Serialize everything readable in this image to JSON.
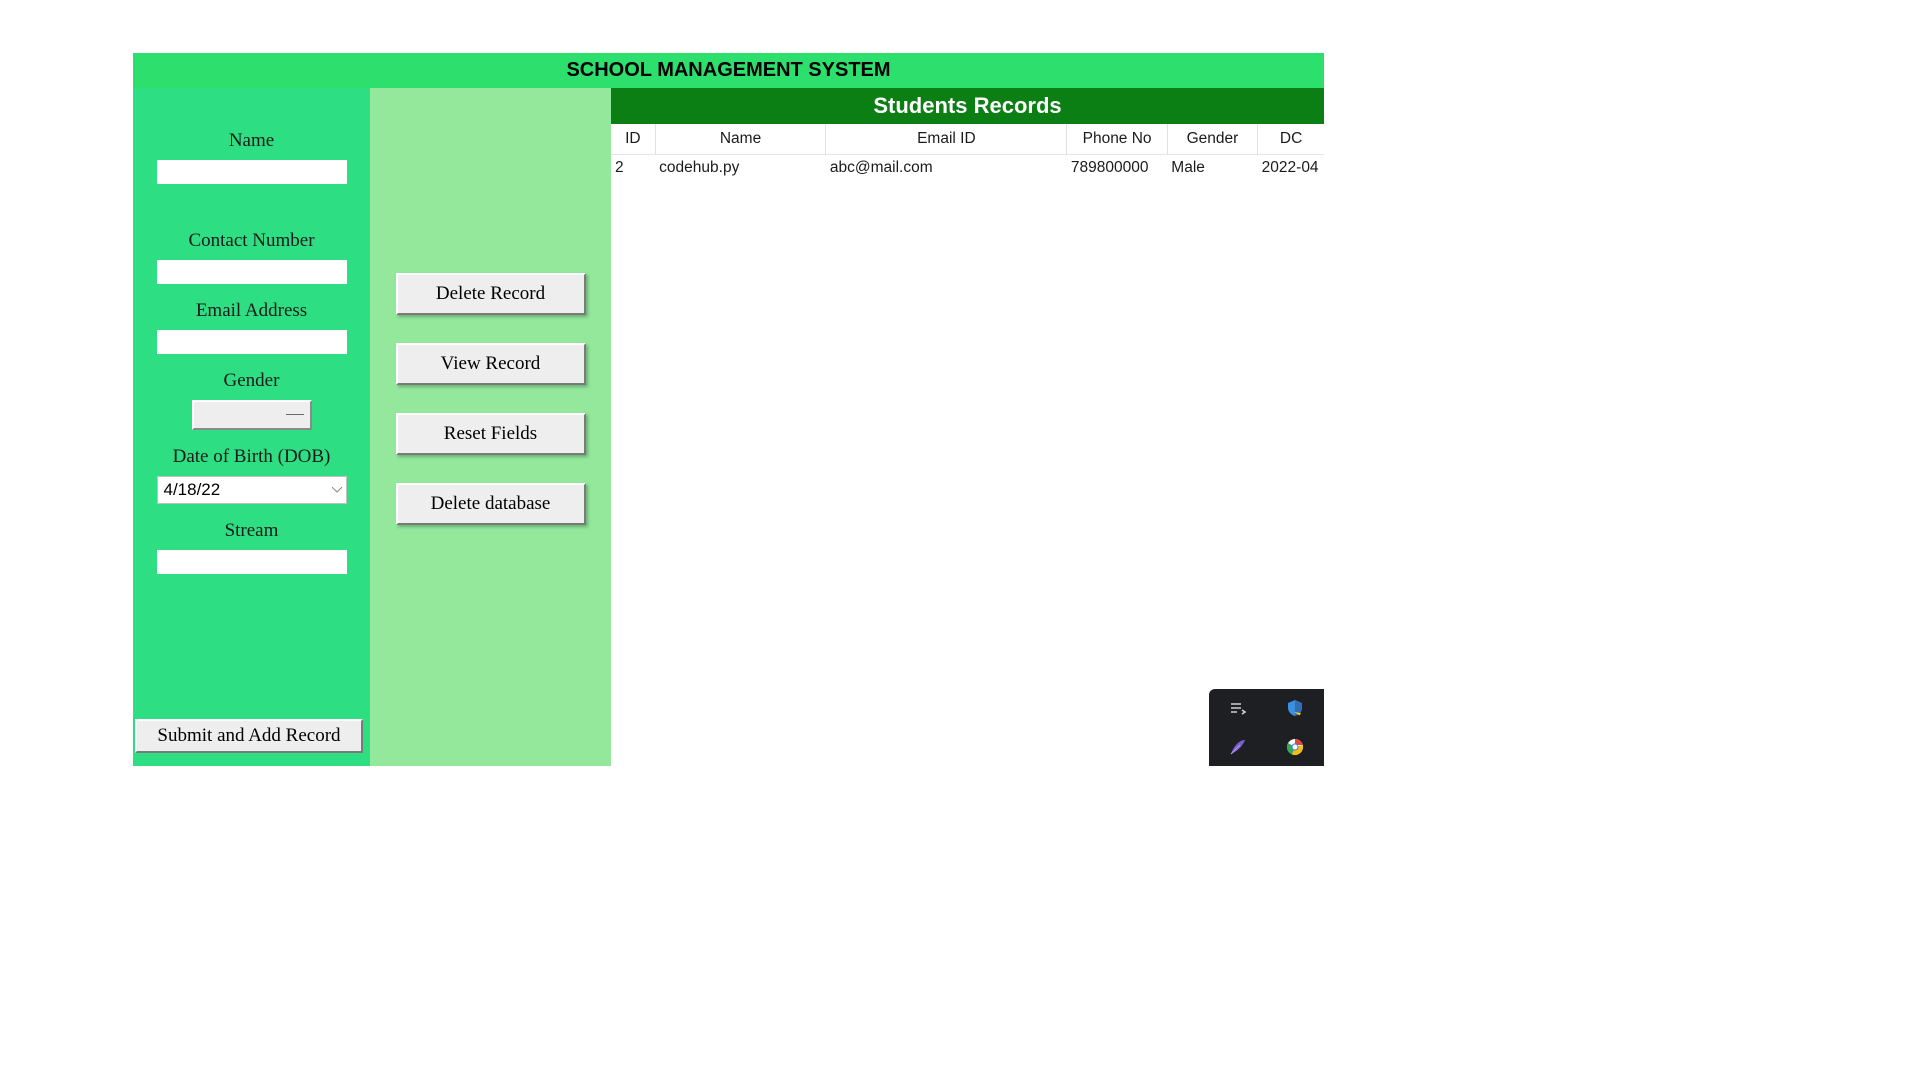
{
  "header": {
    "title": "SCHOOL MANAGEMENT SYSTEM"
  },
  "form": {
    "name_label": "Name",
    "name_value": "",
    "contact_label": "Contact Number",
    "contact_value": "",
    "email_label": "Email Address",
    "email_value": "",
    "gender_label": "Gender",
    "gender_value": "",
    "dob_label": "Date of Birth (DOB)",
    "dob_value": "4/18/22",
    "stream_label": "Stream",
    "stream_value": "",
    "submit_label": "Submit and Add Record"
  },
  "actions": {
    "delete_record": "Delete Record",
    "view_record": "View Record",
    "reset_fields": "Reset Fields",
    "delete_database": "Delete database"
  },
  "records": {
    "title": "Students Records",
    "columns": [
      "ID",
      "Name",
      "Email ID",
      "Phone No",
      "Gender",
      "DC"
    ],
    "rows": [
      {
        "id": "2",
        "name": "codehub.py",
        "email": "abc@mail.com",
        "phone": "789800000",
        "gender": "Male",
        "dob": "2022-04"
      }
    ]
  }
}
